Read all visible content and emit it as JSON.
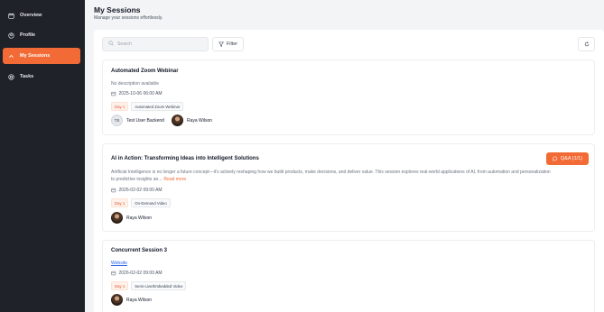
{
  "sidebar": {
    "items": [
      {
        "label": "Overview",
        "icon": "calendar-icon",
        "active": false
      },
      {
        "label": "Profile",
        "icon": "user-icon",
        "active": false
      },
      {
        "label": "My Sessions",
        "icon": "chevron-up-icon",
        "active": true
      },
      {
        "label": "Tasks",
        "icon": "target-icon",
        "active": false
      }
    ]
  },
  "header": {
    "title": "My Sessions",
    "subtitle": "Manage your sessions effortlessly."
  },
  "toolbar": {
    "search_placeholder": "Search",
    "search_value": "",
    "filter_label": "Filter"
  },
  "sessions": [
    {
      "title": "Automated Zoom Webinar",
      "description": "No description available",
      "date": "2025-10-06 06:00 AM",
      "tags": [
        "Day 1",
        "Automated Zoom Webinar"
      ],
      "people": [
        {
          "name": "Test User Backend",
          "initials": "TB"
        },
        {
          "name": "Raya Wilson"
        }
      ]
    },
    {
      "title": "AI in Action: Transforming Ideas into Intelligent Solutions",
      "description_line1": "Artificial Intelligence is no longer a future concept—it's actively reshaping how we build products, make decisions, and deliver value. This session explores real-world applications of AI, from automation and personalization",
      "description_line2": "to predictive insights an...",
      "read_more": "Read more",
      "qa_label": "Q&A (1/1)",
      "date": "2026-02-02 09:00 AM",
      "tags": [
        "Day 1",
        "On-Demand Video"
      ],
      "people": [
        {
          "name": "Raya Wilson"
        }
      ]
    },
    {
      "title": "Concurrent Session 3",
      "link": "Website",
      "date": "2026-02-02 09:00 AM",
      "tags": [
        "Day 1",
        "Semi-Live/Embedded Video"
      ],
      "people": [
        {
          "name": "Raya Wilson"
        }
      ]
    }
  ],
  "colors": {
    "accent": "#f26a35",
    "sidebar_bg": "#1f2228",
    "link": "#2563eb"
  }
}
